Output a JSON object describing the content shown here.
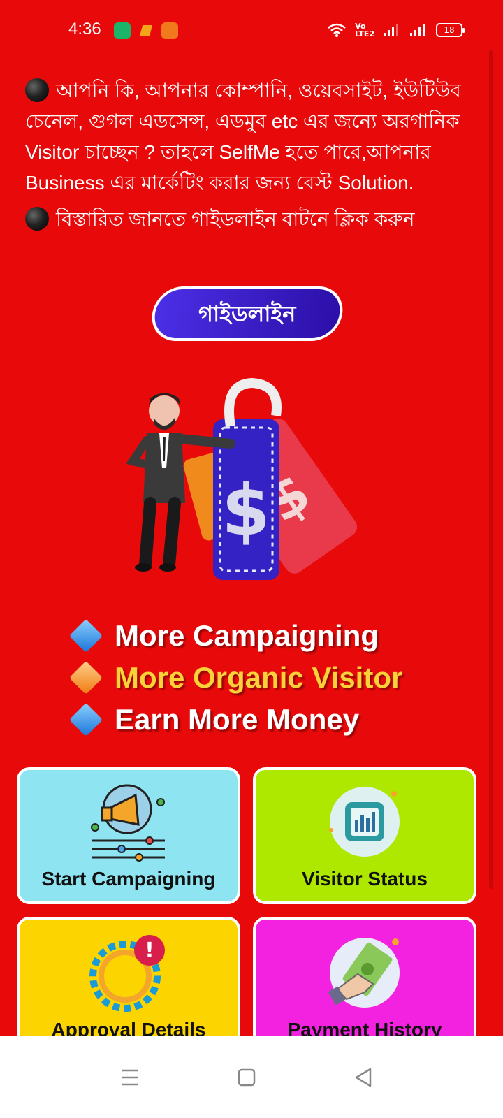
{
  "status_bar": {
    "time": "4:36",
    "notification_icons": [
      "battery-saver-icon",
      "app-icon",
      "app-orange-icon"
    ],
    "volte_label": "Vo\nLTE2",
    "battery_level": "18"
  },
  "intro": {
    "paragraph_1": "আপনি কি, আপনার কোম্পানি, ওয়েবসাইট, ইউটিউব চেনেল, গুগল এডসেন্স, এডমুব etc এর জন্যে অরগানিক Visitor চাচ্ছেন ?  তাহলে SelfMe হতে পারে,আপনার Business এর মার্কেটিং করার জন্য বেস্ট Solution.",
    "paragraph_2": "বিস্তারিত জানতে গাইডলাইন বাটনে ক্লিক করুন"
  },
  "guide_button": {
    "label": "গাইডলাইন"
  },
  "features": [
    {
      "text": "More Campaigning",
      "marker": "blue-diamond-icon"
    },
    {
      "text": "More Organic Visitor",
      "marker": "orange-diamond-icon"
    },
    {
      "text": "Earn More Money",
      "marker": "blue-diamond-icon"
    }
  ],
  "cards": [
    {
      "label": "Start Campaigning",
      "icon": "megaphone-icon"
    },
    {
      "label": "Visitor Status",
      "icon": "bar-chart-icon"
    },
    {
      "label": "Approval Details",
      "icon": "gear-alert-icon"
    },
    {
      "label": "Payment History",
      "icon": "money-hand-icon"
    }
  ],
  "colors": {
    "background": "#e80a0a",
    "card_cyan": "#8fe4f2",
    "card_lime": "#aee800",
    "card_yellow": "#fcd400",
    "card_magenta": "#f322e0",
    "button_blue": "#4b2fe6",
    "highlight_yellow": "#f9d23a"
  }
}
